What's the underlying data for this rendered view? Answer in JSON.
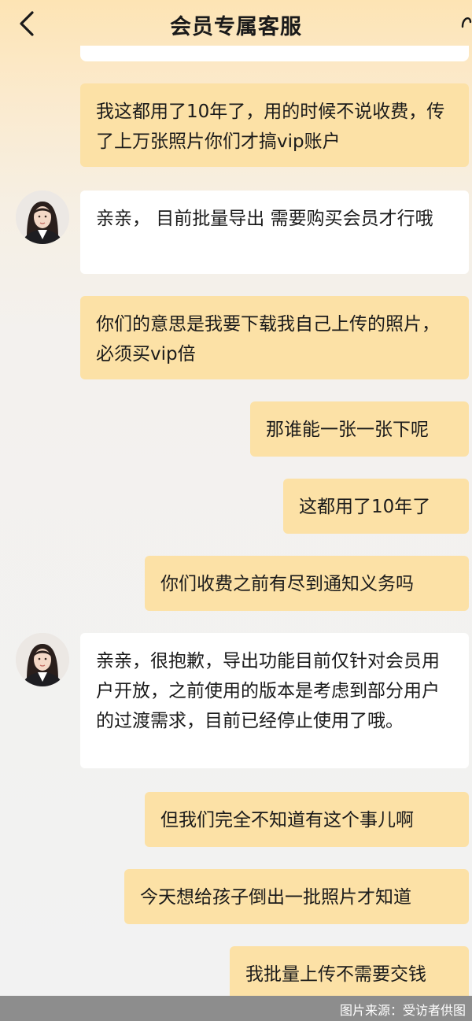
{
  "header": {
    "title": "会员专属客服",
    "back_icon": "chevron-left-icon"
  },
  "messages": [
    {
      "role": "user",
      "text": "我这都用了10年了，用的时候不说收费，传了上万张照片你们才搞vip账户"
    },
    {
      "role": "agent",
      "text": "亲亲， 目前批量导出 需要购买会员才行哦"
    },
    {
      "role": "user",
      "text": "你们的意思是我要下载我自己上传的照片，必须买vip倍"
    },
    {
      "role": "user",
      "text": "那谁能一张一张下呢"
    },
    {
      "role": "user",
      "text": "这都用了10年了"
    },
    {
      "role": "user",
      "text": "你们收费之前有尽到通知义务吗"
    },
    {
      "role": "agent",
      "text": "亲亲，很抱歉，导出功能目前仅针对会员用户开放，之前使用的版本是考虑到部分用户的过渡需求，目前已经停止使用了哦。"
    },
    {
      "role": "user",
      "text": "但我们完全不知道有这个事儿啊"
    },
    {
      "role": "user",
      "text": "今天想给孩子倒出一批照片才知道"
    },
    {
      "role": "user",
      "text": "我批量上传不需要交钱"
    }
  ],
  "caption": "图片来源：受访者供图",
  "colors": {
    "user_bubble": "#fce1a6",
    "agent_bubble": "#ffffff",
    "caption_bar": "#8d8d8d"
  }
}
